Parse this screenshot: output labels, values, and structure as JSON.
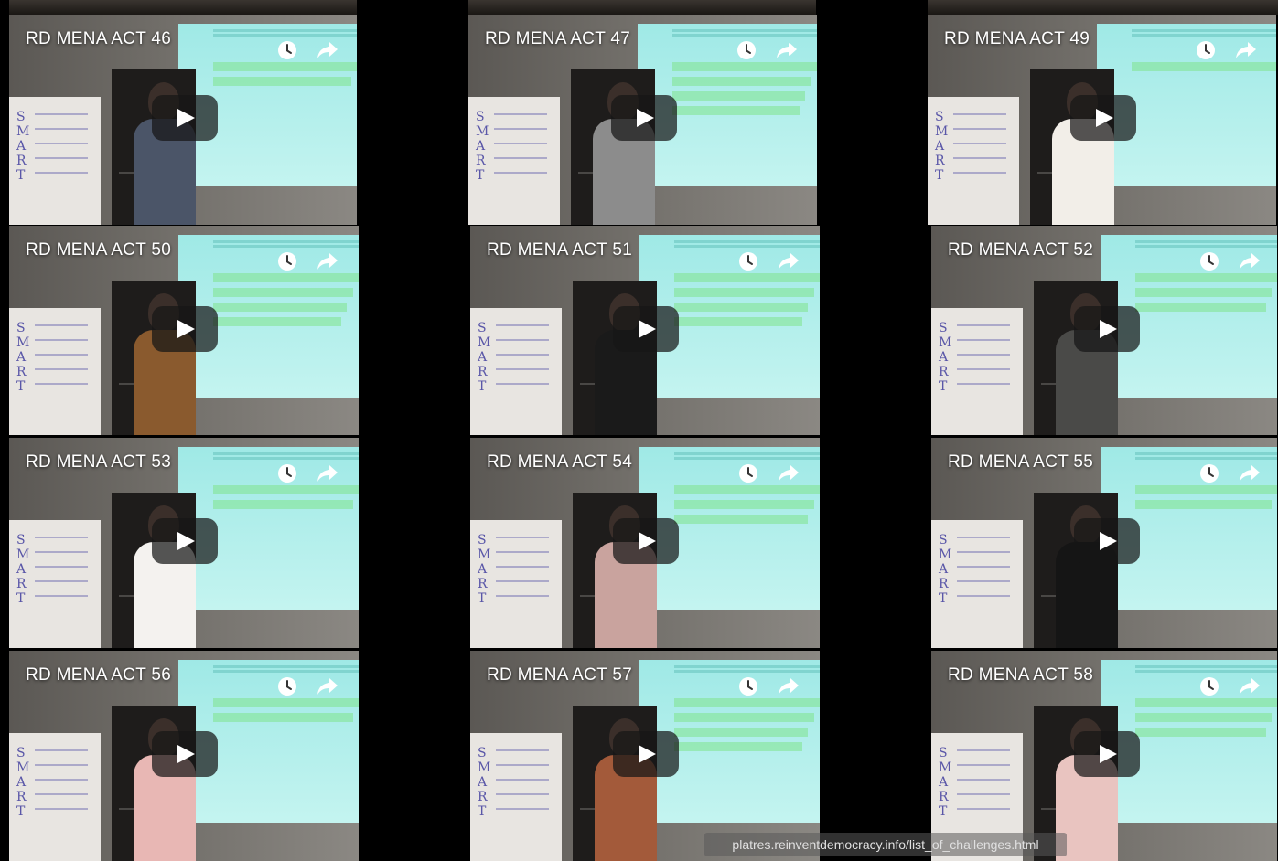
{
  "videos": [
    {
      "title": "RD MENA ACT 46",
      "shirt": "#4b5568",
      "lines": 2
    },
    {
      "title": "RD MENA ACT 47",
      "shirt": "#8c8c8c",
      "lines": 4
    },
    {
      "title": "RD MENA ACT 49",
      "shirt": "#f2eee8",
      "lines": 1
    },
    {
      "title": "RD MENA ACT 50",
      "shirt": "#8a5a2e",
      "lines": 4
    },
    {
      "title": "RD MENA ACT 51",
      "shirt": "#1a1a1a",
      "lines": 4
    },
    {
      "title": "RD MENA ACT 52",
      "shirt": "#4a4a48",
      "lines": 3
    },
    {
      "title": "RD MENA ACT 53",
      "shirt": "#f4f2ef",
      "lines": 2
    },
    {
      "title": "RD MENA ACT 54",
      "shirt": "#c9a39e",
      "lines": 3
    },
    {
      "title": "RD MENA ACT 55",
      "shirt": "#151515",
      "lines": 2
    },
    {
      "title": "RD MENA ACT 56",
      "shirt": "#e8b7b4",
      "lines": 2
    },
    {
      "title": "RD MENA ACT 57",
      "shirt": "#a35a3a",
      "lines": 4
    },
    {
      "title": "RD MENA ACT 58",
      "shirt": "#e9c4c0",
      "lines": 3
    }
  ],
  "controls": {
    "watch_later_icon": "clock-icon",
    "share_icon": "share-arrow-icon",
    "play_icon": "play-triangle-icon"
  },
  "board_letters": "S\nM\nA\nR\nT",
  "status_url": "platres.reinventdemocracy.info/list_of_challenges.html"
}
